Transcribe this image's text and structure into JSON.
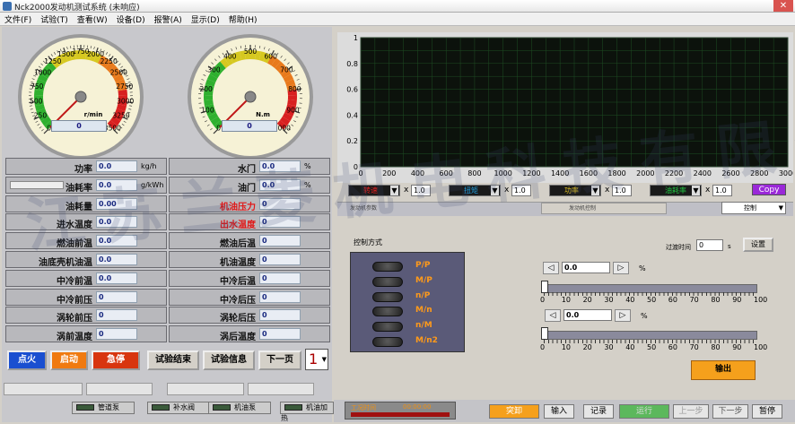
{
  "window": {
    "title": "Nck2000发动机测试系统 (未响应)",
    "close": "✕"
  },
  "menu": [
    "文件(F)",
    "试验(T)",
    "查看(W)",
    "设备(D)",
    "报警(A)",
    "显示(D)",
    "帮助(H)"
  ],
  "gauges": [
    {
      "unit": "r/min",
      "value": "0",
      "ticks": [
        "0",
        "250",
        "500",
        "750",
        "1000",
        "1250",
        "1500",
        "1750",
        "2000",
        "2250",
        "2500",
        "2750",
        "3000",
        "3250",
        "3500"
      ],
      "max": 3500,
      "reading": 0
    },
    {
      "unit": "N.m",
      "value": "0",
      "ticks": [
        "0",
        "100",
        "200",
        "300",
        "400",
        "500",
        "600",
        "700",
        "800",
        "900",
        "1000"
      ],
      "max": 1000,
      "reading": 0
    }
  ],
  "params_left": [
    {
      "label": "功率",
      "value": "0.0",
      "unit": "kg/h",
      "red": false
    },
    {
      "label": "油耗率",
      "value": "0.0",
      "unit": "g/kWh",
      "red": false
    },
    {
      "label": "油耗量",
      "value": "0.00",
      "unit": "",
      "red": false
    },
    {
      "label": "进水温度",
      "value": "0.0",
      "unit": "",
      "red": false
    },
    {
      "label": "燃油前温",
      "value": "0.0",
      "unit": "",
      "red": false
    },
    {
      "label": "油底壳机油温",
      "value": "0.0",
      "unit": "",
      "red": false
    },
    {
      "label": "中冷前温",
      "value": "0.0",
      "unit": "",
      "red": false
    },
    {
      "label": "中冷前压",
      "value": "0",
      "unit": "",
      "red": false
    },
    {
      "label": "涡轮前压",
      "value": "0",
      "unit": "",
      "red": false
    },
    {
      "label": "涡前温度",
      "value": "0",
      "unit": "",
      "red": false
    }
  ],
  "params_right": [
    {
      "label": "水门",
      "value": "0.0",
      "unit": "%",
      "red": false
    },
    {
      "label": "油门",
      "value": "0.0",
      "unit": "%",
      "red": false
    },
    {
      "label": "机油压力",
      "value": "0",
      "unit": "",
      "red": true
    },
    {
      "label": "出水温度",
      "value": "0",
      "unit": "",
      "red": true
    },
    {
      "label": "燃油后温",
      "value": "0",
      "unit": "",
      "red": false
    },
    {
      "label": "机油温度",
      "value": "0",
      "unit": "",
      "red": false
    },
    {
      "label": "中冷后温",
      "value": "0",
      "unit": "",
      "red": false
    },
    {
      "label": "中冷后压",
      "value": "0",
      "unit": "",
      "red": false
    },
    {
      "label": "涡轮后压",
      "value": "0",
      "unit": "",
      "red": false
    },
    {
      "label": "涡后温度",
      "value": "0",
      "unit": "",
      "red": false
    }
  ],
  "buttons": {
    "ignite": "点火",
    "start": "启动",
    "estop": "急停",
    "end_test": "试验结束",
    "test_info": "试验信息",
    "next_page": "下一页",
    "page": "1"
  },
  "indicators": [
    "管道泵",
    "补水阀",
    "机油泵",
    "机油加热"
  ],
  "chart": {
    "x_ticks": [
      "0",
      "200",
      "400",
      "600",
      "800",
      "1000",
      "1200",
      "1400",
      "1600",
      "1800",
      "2000",
      "2200",
      "2400",
      "2600",
      "2800",
      "3000"
    ],
    "y_ticks": [
      "1",
      "0.8",
      "0.6",
      "0.4",
      "0.2",
      "0"
    ],
    "copy": "Copy",
    "bg": "#0c120c",
    "grid": "#1f4f24"
  },
  "channels": [
    {
      "name": "转速",
      "color": "#e02020",
      "mult": "1.0"
    },
    {
      "name": "扭矩",
      "color": "#20a0e0",
      "mult": "1.0"
    },
    {
      "name": "功率",
      "color": "#e0c020",
      "mult": "1.0"
    },
    {
      "name": "油耗率",
      "color": "#20c040",
      "mult": "1.0"
    }
  ],
  "tabs": [
    "发动机参数",
    "发动机控制"
  ],
  "control_select": "控制",
  "control": {
    "title": "控制方式",
    "transition_label": "过渡时间",
    "transition_value": "0",
    "transition_unit": "s",
    "settings": "设置",
    "modes": [
      "P/P",
      "M/P",
      "n/P",
      "M/n",
      "n/M",
      "M/n2"
    ],
    "set1": "0.0",
    "set2": "0.0",
    "pct": "%",
    "scale": [
      "0",
      "10",
      "20",
      "30",
      "40",
      "50",
      "60",
      "70",
      "80",
      "90",
      "100"
    ],
    "output": "输出"
  },
  "bottom": {
    "timer_label": "工况时间",
    "timer": "00:00:00",
    "sudden": "突卸",
    "input": "输入",
    "record": "记录",
    "run": "运行",
    "prev": "上一步",
    "next": "下一步",
    "pause": "暂停"
  },
  "watermark": "江苏兰菱机电科技有限公司"
}
